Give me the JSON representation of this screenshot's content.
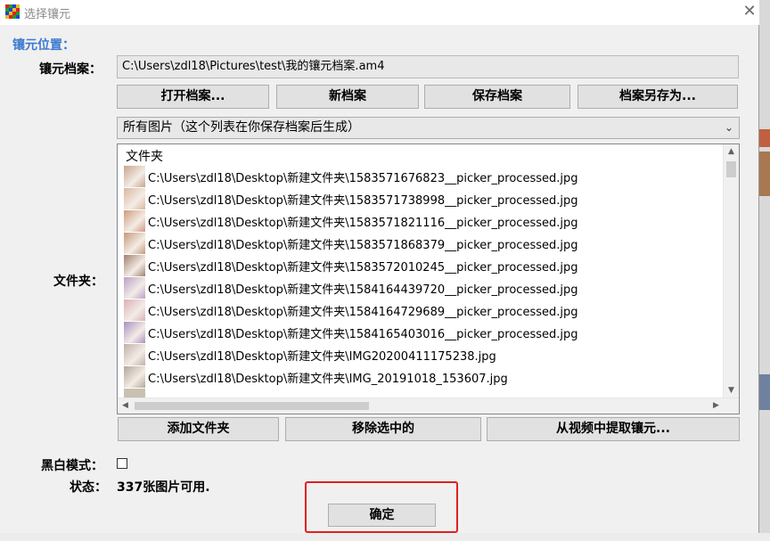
{
  "window": {
    "title": "选择镶元",
    "close_glyph": "✕"
  },
  "section_label": "镶元位置：",
  "archive": {
    "label": "镶元档案：",
    "path": "C:\\Users\\zdl18\\Pictures\\test\\我的镶元档案.am4",
    "buttons": {
      "open": "打开档案...",
      "new": "新档案",
      "save": "保存档案",
      "save_as": "档案另存为..."
    }
  },
  "filter": {
    "selected": "所有图片（这个列表在你保存档案后生成）",
    "chevron": "⌄"
  },
  "folder_label": "文件夹：",
  "list": {
    "header": "文件夹",
    "items": [
      {
        "path": "C:\\Users\\zdl18\\Desktop\\新建文件夹\\1583571676823__picker_processed.jpg",
        "thumb": "#c8a48c"
      },
      {
        "path": "C:\\Users\\zdl18\\Desktop\\新建文件夹\\1583571738998__picker_processed.jpg",
        "thumb": "#d8b8a0"
      },
      {
        "path": "C:\\Users\\zdl18\\Desktop\\新建文件夹\\1583571821116__picker_processed.jpg",
        "thumb": "#d09a7c"
      },
      {
        "path": "C:\\Users\\zdl18\\Desktop\\新建文件夹\\1583571868379__picker_processed.jpg",
        "thumb": "#c69878"
      },
      {
        "path": "C:\\Users\\zdl18\\Desktop\\新建文件夹\\1583572010245__picker_processed.jpg",
        "thumb": "#a08070"
      },
      {
        "path": "C:\\Users\\zdl18\\Desktop\\新建文件夹\\1584164439720__picker_processed.jpg",
        "thumb": "#b8a0c8"
      },
      {
        "path": "C:\\Users\\zdl18\\Desktop\\新建文件夹\\1584164729689__picker_processed.jpg",
        "thumb": "#d8b0b8"
      },
      {
        "path": "C:\\Users\\zdl18\\Desktop\\新建文件夹\\1584165403016__picker_processed.jpg",
        "thumb": "#a890c0"
      },
      {
        "path": "C:\\Users\\zdl18\\Desktop\\新建文件夹\\IMG20200411175238.jpg",
        "thumb": "#c0b0a8"
      },
      {
        "path": "C:\\Users\\zdl18\\Desktop\\新建文件夹\\IMG_20191018_153607.jpg",
        "thumb": "#b0a898"
      }
    ]
  },
  "folder_buttons": {
    "add": "添加文件夹",
    "remove": "移除选中的",
    "extract": "从视频中提取镶元..."
  },
  "bw_mode": {
    "label": "黑白模式：",
    "checked": false
  },
  "status": {
    "label": "状态：",
    "value": "337张图片可用."
  },
  "ok_button": "确定",
  "colors": {
    "accent_label": "#3a7ad0",
    "highlight_border": "#e02020",
    "window_bg": "#f0f0f0"
  }
}
